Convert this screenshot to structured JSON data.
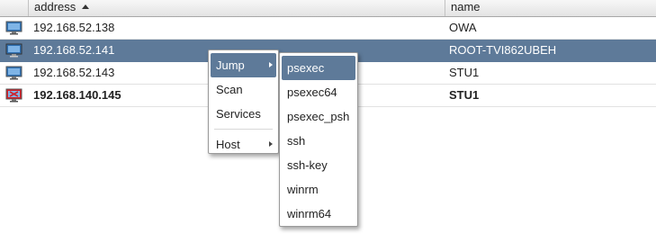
{
  "table": {
    "columns": {
      "address": "address",
      "name": "name"
    },
    "sort": {
      "column": "address",
      "direction": "ascending"
    },
    "rows": [
      {
        "icon": "windows-host-icon",
        "address": "192.168.52.138",
        "name": "OWA",
        "selected": false,
        "bold": false
      },
      {
        "icon": "windows-host-icon",
        "address": "192.168.52.141",
        "name": "ROOT-TVI862UBEH",
        "selected": true,
        "bold": false
      },
      {
        "icon": "windows-host-icon",
        "address": "192.168.52.143",
        "name": "STU1",
        "selected": false,
        "bold": false
      },
      {
        "icon": "windows-host-compromised-icon",
        "address": "192.168.140.145",
        "name": "STU1",
        "selected": false,
        "bold": true
      }
    ]
  },
  "context_menu": {
    "items": [
      "Jump",
      "Scan",
      "Services",
      "Host"
    ],
    "active": "Jump"
  },
  "jump_submenu": {
    "items": [
      "psexec",
      "psexec64",
      "psexec_psh",
      "ssh",
      "ssh-key",
      "winrm",
      "winrm64"
    ],
    "active": "psexec"
  },
  "colors": {
    "selection": "#5e7a99",
    "compromised_accent": "#d2202a"
  }
}
